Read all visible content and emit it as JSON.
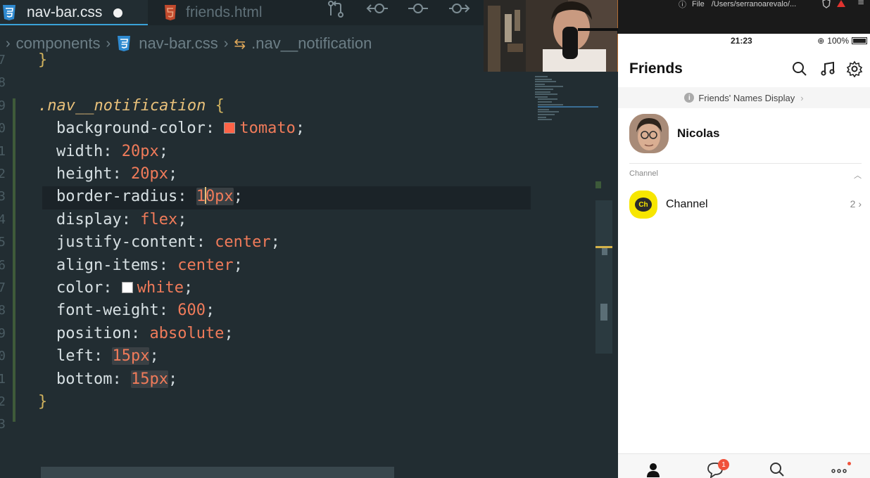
{
  "tabs": [
    {
      "label": "nav-bar.css",
      "icon": "css3-icon",
      "modified": true
    },
    {
      "label": "friends.html",
      "icon": "html5-icon",
      "modified": false
    }
  ],
  "breadcrumb": {
    "folder": "components",
    "file": "nav-bar.css",
    "symbol": ".nav__notification"
  },
  "code": {
    "line_numbers": [
      "7",
      "8",
      "9",
      "0",
      "1",
      "2",
      "3",
      "4",
      "5",
      "6",
      "7",
      "8",
      "9",
      "0",
      "1",
      "2",
      "3"
    ],
    "prev_brace": "}",
    "selector": ".nav__notification",
    "open_brace": "{",
    "close_brace": "}",
    "declarations": [
      {
        "prop": "background-color",
        "value": "tomato",
        "swatch": "#ff6347"
      },
      {
        "prop": "width",
        "value": "20px"
      },
      {
        "prop": "height",
        "value": "20px"
      },
      {
        "prop": "border-radius",
        "value_a": "1",
        "value_b": "0px"
      },
      {
        "prop": "display",
        "value": "flex"
      },
      {
        "prop": "justify-content",
        "value": "center"
      },
      {
        "prop": "align-items",
        "value": "center"
      },
      {
        "prop": "color",
        "value": "white",
        "swatch": "#ffffff"
      },
      {
        "prop": "font-weight",
        "value": "600"
      },
      {
        "prop": "position",
        "value": "absolute"
      },
      {
        "prop": "left",
        "value": "15px"
      },
      {
        "prop": "bottom",
        "value": "15px"
      }
    ]
  },
  "browser": {
    "url_label": "File",
    "url": "/Users/serranoarevalo/..."
  },
  "phone": {
    "status_time": "21:23",
    "battery": "100%",
    "title": "Friends",
    "banner": "Friends' Names Display",
    "profile_name": "Nicolas",
    "channel_section": "Channel",
    "channel_logo_text": "Ch",
    "channel_name": "Channel",
    "channel_count": "2",
    "chat_badge": "1"
  },
  "colors": {
    "editor_bg": "#222d32",
    "accent_blue": "#3aa2d8",
    "value_orange": "#f07b5a",
    "kakao_yellow": "#f7e600",
    "badge_red": "#f0523b"
  }
}
